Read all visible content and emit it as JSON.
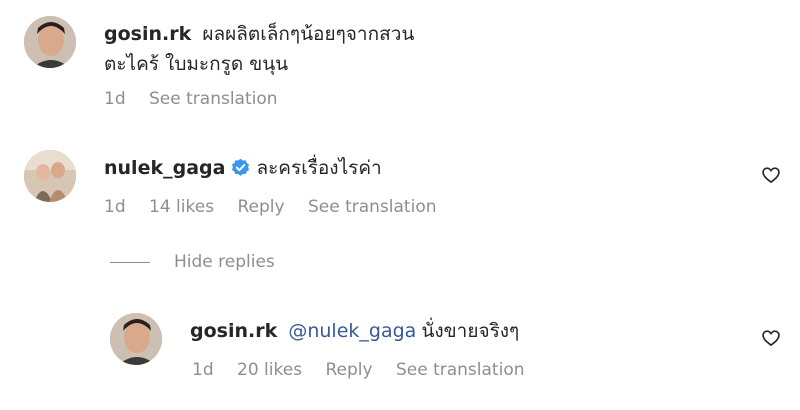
{
  "comments": [
    {
      "username": "gosin.rk",
      "text_line1": "ผลผลิตเล็กๆน้อยๆจากสวน",
      "text_line2": "ตะไคร้ ใบมะกรูด ขนุน",
      "time": "1d",
      "see_translation": "See translation"
    },
    {
      "username": "nulek_gaga",
      "verified_icon": "verified-badge-icon",
      "text": "ละครเรื่องไรค่า",
      "time": "1d",
      "likes": "14 likes",
      "reply": "Reply",
      "see_translation": "See translation"
    }
  ],
  "replies_toggle": {
    "label": "Hide replies"
  },
  "reply": {
    "username": "gosin.rk",
    "mention": "@nulek_gaga",
    "text": "นั่งขายจริงๆ",
    "time": "1d",
    "likes": "20 likes",
    "reply": "Reply",
    "see_translation": "See translation"
  },
  "colors": {
    "verified": "#3897f0",
    "mention": "#385898",
    "meta": "#8e8e8e"
  }
}
